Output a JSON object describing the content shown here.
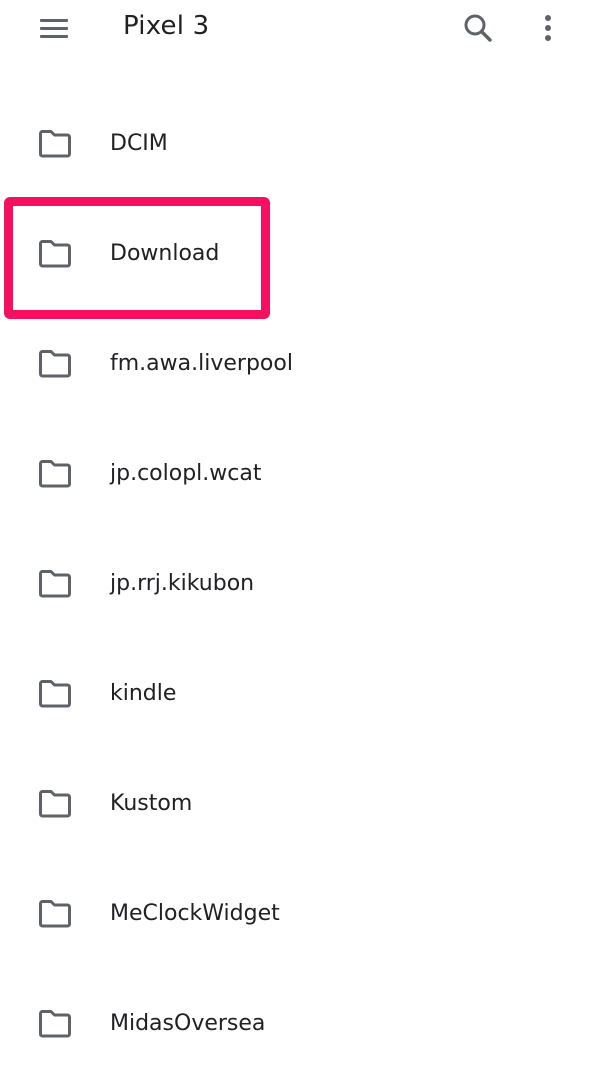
{
  "header": {
    "title": "Pixel 3",
    "menu_icon": "menu-icon",
    "search_icon": "search-icon",
    "overflow_icon": "more-vert-icon"
  },
  "folders": [
    {
      "label": "DCIM",
      "icon": "folder-icon"
    },
    {
      "label": "Download",
      "icon": "folder-icon"
    },
    {
      "label": "fm.awa.liverpool",
      "icon": "folder-icon"
    },
    {
      "label": "jp.colopl.wcat",
      "icon": "folder-icon"
    },
    {
      "label": "jp.rrj.kikubon",
      "icon": "folder-icon"
    },
    {
      "label": "kindle",
      "icon": "folder-icon"
    },
    {
      "label": "Kustom",
      "icon": "folder-icon"
    },
    {
      "label": "MeClockWidget",
      "icon": "folder-icon"
    },
    {
      "label": "MidasOversea",
      "icon": "folder-icon"
    }
  ],
  "highlight": {
    "target": "Download",
    "color": "#f5115f"
  },
  "colors": {
    "icon_gray": "#5f6368",
    "text": "#202124",
    "background": "#ffffff"
  }
}
